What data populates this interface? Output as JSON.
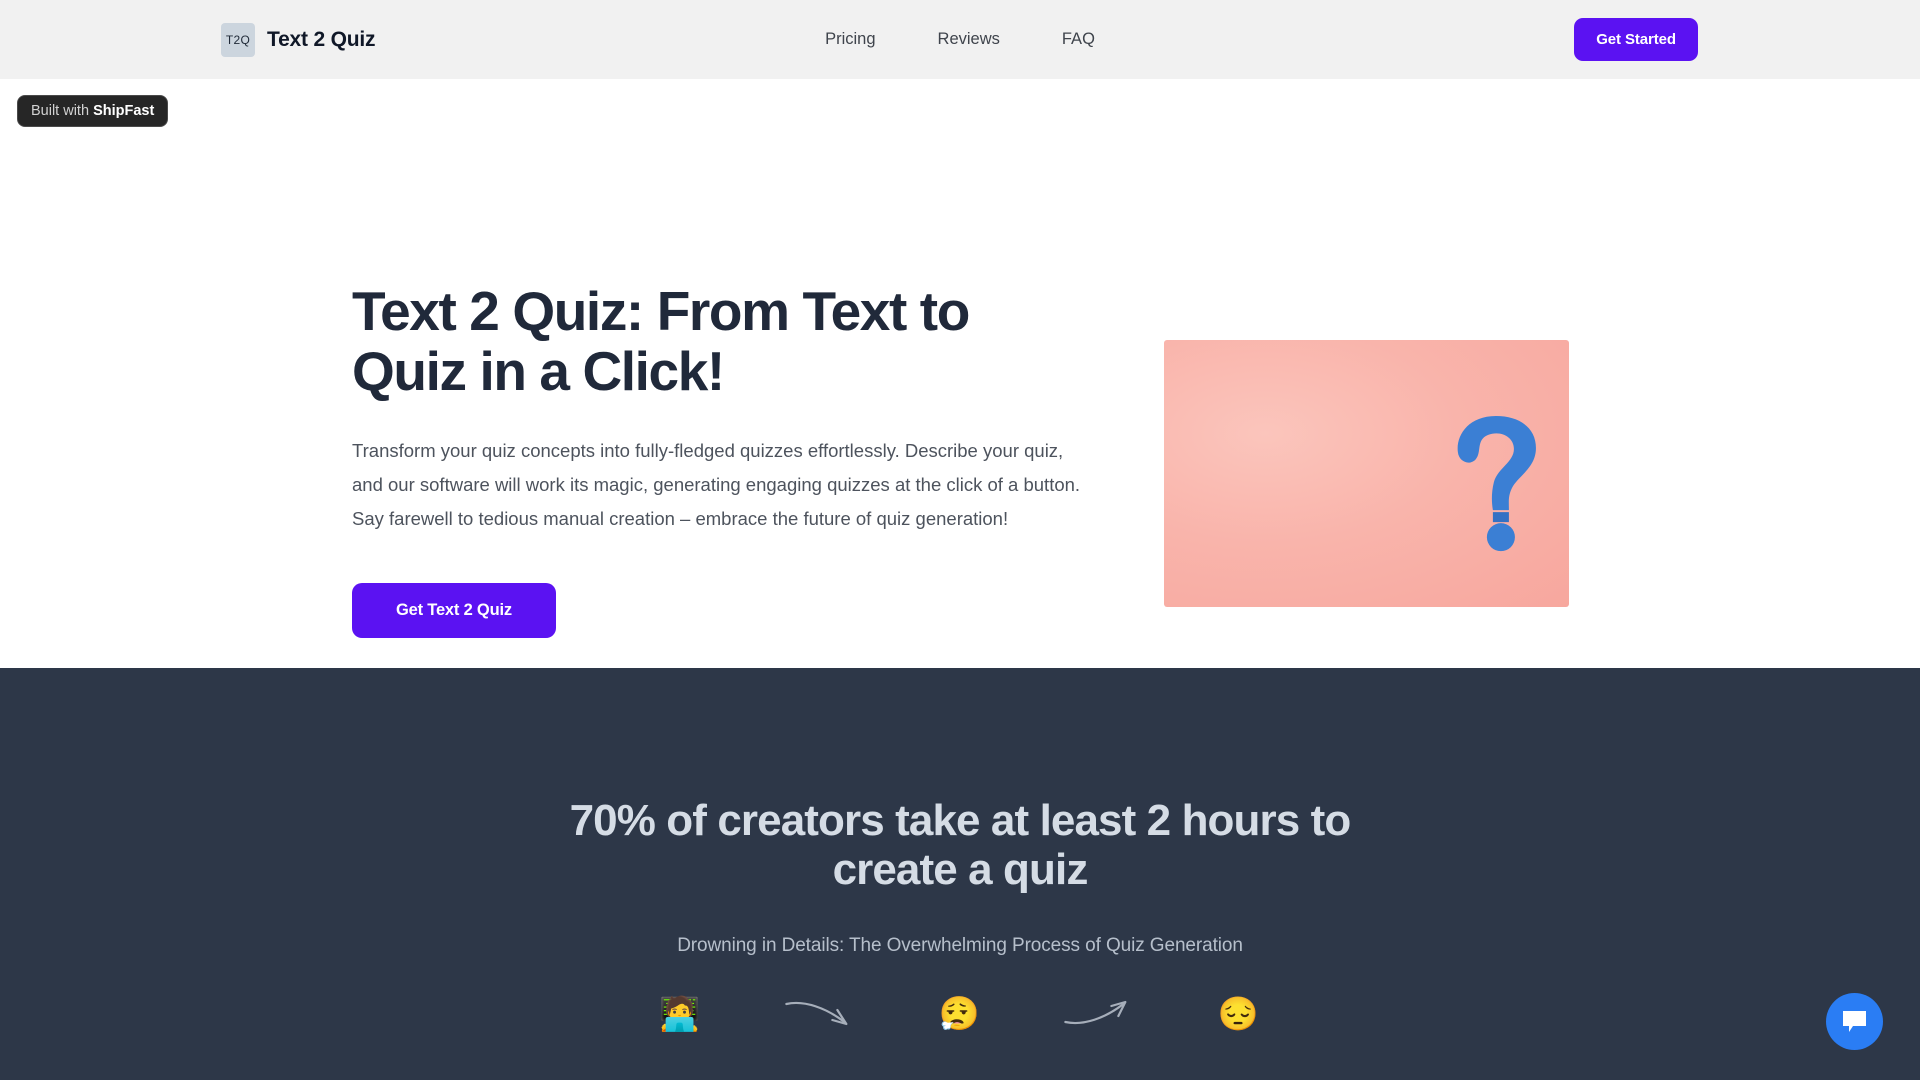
{
  "header": {
    "brand": {
      "logo_text": "T2Q",
      "name": "Text 2 Quiz"
    },
    "nav": [
      {
        "label": "Pricing"
      },
      {
        "label": "Reviews"
      },
      {
        "label": "FAQ"
      }
    ],
    "cta_label": "Get Started"
  },
  "badge": {
    "prefix": "Built with ",
    "brand": "ShipFast"
  },
  "hero": {
    "title": "Text 2 Quiz: From Text to Quiz in a Click!",
    "description": "Transform your quiz concepts into fully-fledged quizzes effortlessly. Describe your quiz, and our software will work its magic, generating engaging quizzes at the click of a button. Say farewell to tedious manual creation – embrace the future of quiz generation!",
    "cta_label": "Get Text 2 Quiz",
    "image_alt": "blue question mark on pink background"
  },
  "problem": {
    "title": "70% of creators take at least 2 hours to create a quiz",
    "subtitle": "Drowning in Details: The Overwhelming Process of Quiz Generation",
    "flow": [
      {
        "type": "emoji",
        "value": "🧑‍💻",
        "name": "person-at-laptop-emoji"
      },
      {
        "type": "arrow",
        "value": "arrow-curve-down-right",
        "name": "arrow-down-right-icon"
      },
      {
        "type": "emoji",
        "value": "😮‍💨",
        "name": "face-exhaling-emoji"
      },
      {
        "type": "arrow",
        "value": "arrow-curve-up-right",
        "name": "arrow-up-right-icon"
      },
      {
        "type": "emoji",
        "value": "😔",
        "name": "pensive-face-emoji"
      }
    ]
  },
  "chat": {
    "icon": "chat-bubble-icon",
    "color": "#2a7df4"
  },
  "colors": {
    "accent": "#5b12f2",
    "header_bg": "#f1f1f1",
    "dark_section_bg": "#2d3748",
    "heading": "#20293a"
  }
}
